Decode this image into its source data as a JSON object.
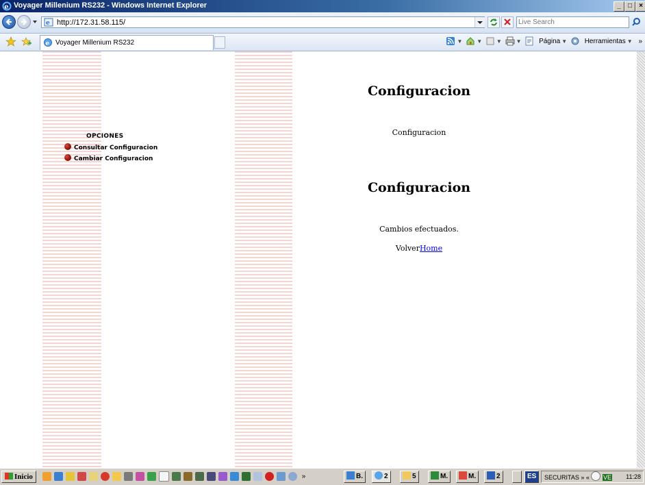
{
  "window": {
    "title": "Voyager Millenium RS232 - Windows Internet Explorer",
    "minimize_label": "_",
    "maximize_label": "□",
    "close_label": "×"
  },
  "addressbar": {
    "url": "http://172.31.58.115/",
    "search_placeholder": "Live Search"
  },
  "tabs": [
    {
      "label": "Voyager Millenium RS232",
      "active": true
    }
  ],
  "commandbar": {
    "page_label": "Página",
    "tools_label": "Herramientas",
    "more_label": "»"
  },
  "sidebar": {
    "heading": "OPCIONES",
    "items": [
      {
        "label": "Consultar Configuracion"
      },
      {
        "label": "Cambiar Configuracion"
      }
    ]
  },
  "main": {
    "heading1": "Configuracion",
    "text1": "Configuracion",
    "heading2": "Configuracion",
    "status": "Cambios efectuados.",
    "back_prefix": "Volver",
    "home_link": "Home"
  },
  "taskbar": {
    "start_label": "Inicio",
    "overflow_label": "»",
    "buttons": [
      {
        "label": "B."
      },
      {
        "label": "2"
      },
      {
        "label": "5"
      },
      {
        "label": "M."
      },
      {
        "label": "M."
      },
      {
        "label": "2"
      },
      {
        "label": "ES"
      }
    ],
    "tray_label": "SECURITAS",
    "tray_overflow": "»",
    "tray_collapse": "«",
    "tray_app": "VE",
    "clock": "11:28"
  },
  "colors": {
    "stripe": "#f6d4cf",
    "bullet": "#b3170d",
    "link": "#0000ee",
    "titlebar_start": "#0a246a"
  }
}
